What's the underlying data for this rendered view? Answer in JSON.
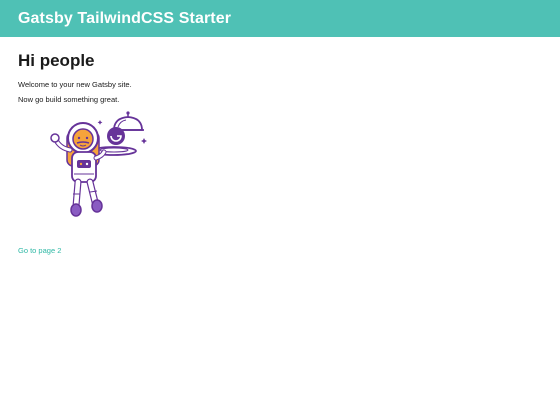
{
  "header": {
    "title": "Gatsby TailwindCSS Starter"
  },
  "main": {
    "heading": "Hi people",
    "paragraphs": [
      "Welcome to your new Gatsby site.",
      "Now go build something great."
    ],
    "link": "Go to page 2"
  },
  "illustration": {
    "icon": "astronaut-waiter-icon"
  },
  "colors": {
    "header_bg": "#4fc1b5",
    "link": "#2eb8a5",
    "purple": "#663399",
    "orange": "#f6a33b"
  }
}
